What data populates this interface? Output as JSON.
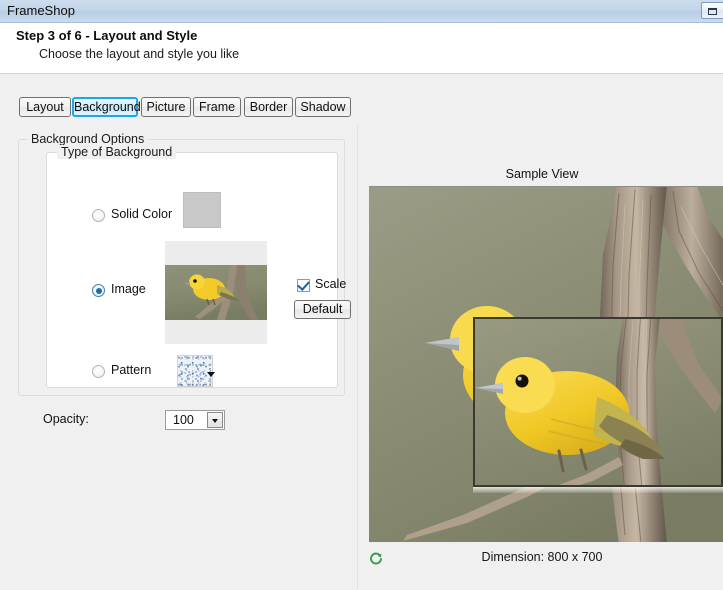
{
  "window": {
    "title": "FrameShop",
    "restore_button_icon": "restore-window-icon"
  },
  "header": {
    "title": "Step 3 of 6 - Layout and Style",
    "subtitle": "Choose the layout and style you like"
  },
  "tabs": [
    {
      "label": "Layout",
      "selected": false
    },
    {
      "label": "Background",
      "selected": true
    },
    {
      "label": "Picture",
      "selected": false
    },
    {
      "label": "Frame",
      "selected": false
    },
    {
      "label": "Border",
      "selected": false
    },
    {
      "label": "Shadow",
      "selected": false
    }
  ],
  "background_options": {
    "group_label": "Background Options",
    "type_group_label": "Type of Background",
    "types": [
      {
        "label": "Solid Color",
        "selected": false,
        "swatch": "solid-gray-swatch",
        "color": "#c8c8c8"
      },
      {
        "label": "Image",
        "selected": true,
        "preview": "yellow-warbler-photo"
      },
      {
        "label": "Pattern",
        "selected": false,
        "swatch": "noise-pattern-swatch"
      }
    ],
    "scale_checkbox": {
      "label": "Scale",
      "checked": true
    },
    "default_button": {
      "label": "Default"
    },
    "opacity": {
      "label": "Opacity:",
      "value": "100"
    }
  },
  "sample_view": {
    "title": "Sample View",
    "dimension_text": "Dimension: 800 x 700",
    "refresh_icon": "refresh-icon",
    "refresh_icon_color": "#3a9c4e"
  }
}
